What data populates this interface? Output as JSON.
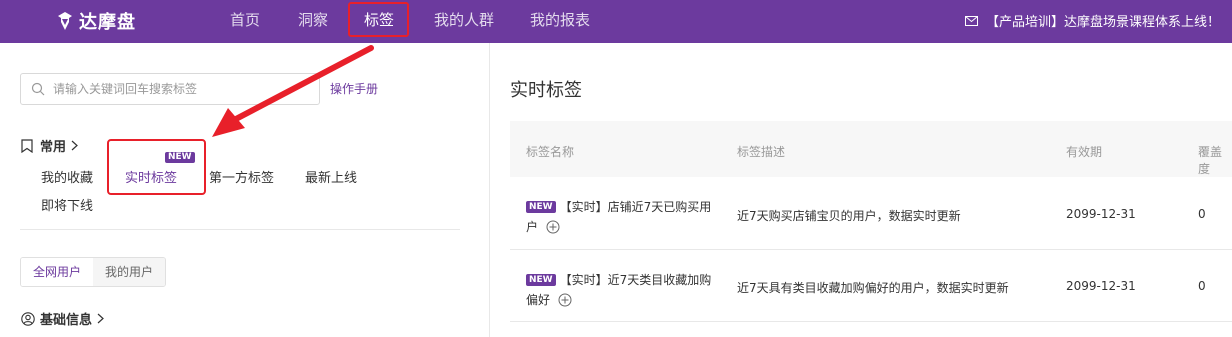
{
  "header": {
    "logo_text": "达摩盘",
    "nav": [
      {
        "label": "首页",
        "active": false
      },
      {
        "label": "洞察",
        "active": false
      },
      {
        "label": "标签",
        "active": true
      },
      {
        "label": "我的人群",
        "active": false
      },
      {
        "label": "我的报表",
        "active": false
      }
    ],
    "announcement": "【产品培训】达摩盘场景课程体系上线！"
  },
  "sidebar": {
    "search_placeholder": "请输入关键词回车搜索标签",
    "manual_link": "操作手册",
    "common_section": {
      "title": "常用",
      "new_badge": "NEW",
      "links": [
        {
          "label": "我的收藏",
          "active": false
        },
        {
          "label": "实时标签",
          "active": true
        },
        {
          "label": "第一方标签",
          "active": false
        },
        {
          "label": "最新上线",
          "active": false
        },
        {
          "label": "即将下线",
          "active": false
        }
      ]
    },
    "user_tabs": [
      {
        "label": "全网用户",
        "active": true
      },
      {
        "label": "我的用户",
        "active": false
      }
    ],
    "basic_section": {
      "title": "基础信息"
    }
  },
  "main": {
    "title": "实时标签",
    "table": {
      "columns": [
        "标签名称",
        "标签描述",
        "有效期",
        "覆盖度"
      ],
      "rows": [
        {
          "badge": "NEW",
          "name": "【实时】店铺近7天已购买用户",
          "description": "近7天购买店铺宝贝的用户，数据实时更新",
          "expiry": "2099-12-31",
          "coverage": "0"
        },
        {
          "badge": "NEW",
          "name": "【实时】近7天类目收藏加购偏好",
          "description": "近7天具有类目收藏加购偏好的用户，数据实时更新",
          "expiry": "2099-12-31",
          "coverage": "0"
        }
      ]
    }
  },
  "colors": {
    "brand_purple": "#6c3a9e",
    "highlight_red": "#e8202a"
  }
}
